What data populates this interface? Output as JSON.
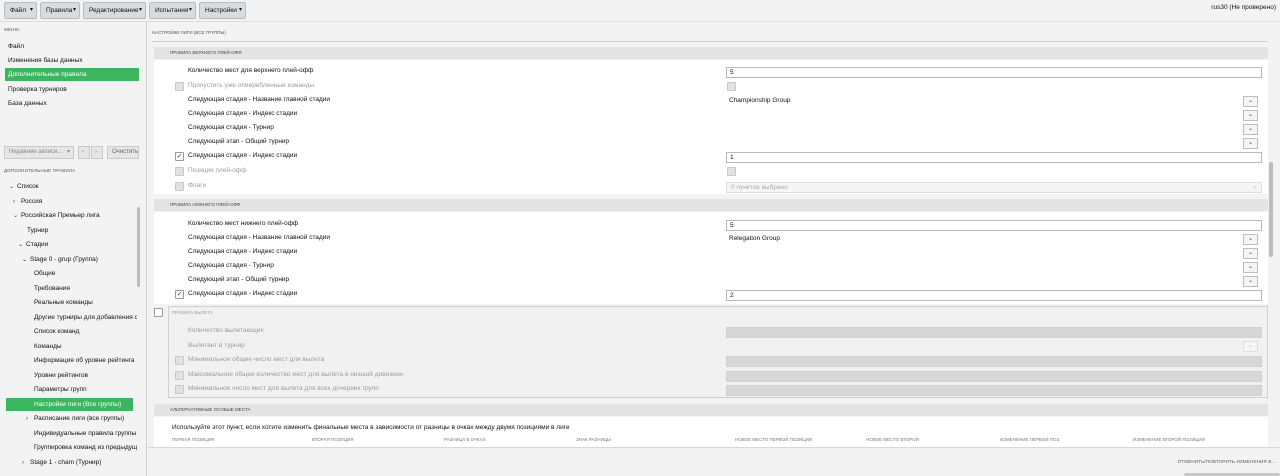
{
  "topbar": {
    "menus": [
      {
        "label": "Файл"
      },
      {
        "label": "Правила"
      },
      {
        "label": "Редактирование"
      },
      {
        "label": "Испытания"
      },
      {
        "label": "Настройки"
      }
    ],
    "user": "rus30 (Не проверено)"
  },
  "left": {
    "menu_title": "МЕНЮ",
    "nav": [
      "Файл",
      "Изменения базы данных",
      "Дополнительные правила",
      "Проверка турниров",
      "База данных"
    ],
    "history_placeholder": "Недавние записи...",
    "clear_label": "Очистить",
    "tree_title": "ДОПОЛНИТЕЛЬНЫЕ ПРАВИЛА",
    "tree": [
      {
        "label": "Список",
        "arrow": "down"
      },
      {
        "label": "Россия",
        "arrow": "right"
      },
      {
        "label": "Российская Премьер лига",
        "arrow": "down"
      },
      {
        "label": "Турнир",
        "arrow": ""
      },
      {
        "label": "Стадии",
        "arrow": "down"
      },
      {
        "label": "Stage 0 - grup (Группа)",
        "arrow": "down"
      },
      {
        "label": "Общие",
        "arrow": ""
      },
      {
        "label": "Требования",
        "arrow": ""
      },
      {
        "label": "Реальные команды",
        "arrow": ""
      },
      {
        "label": "Другие турниры для добавления ст",
        "arrow": ""
      },
      {
        "label": "Список команд",
        "arrow": ""
      },
      {
        "label": "Команды",
        "arrow": ""
      },
      {
        "label": "Информация об уровне рейтинга",
        "arrow": ""
      },
      {
        "label": "Уровни рейтингов",
        "arrow": ""
      },
      {
        "label": "Параметры групп",
        "arrow": ""
      },
      {
        "label": "Настройки лиги (Все группы)",
        "arrow": ""
      },
      {
        "label": "Расписание лиги (все группы)",
        "arrow": "right"
      },
      {
        "label": "Индивидуальные правила группы",
        "arrow": ""
      },
      {
        "label": "Группировка команд из предыдущ",
        "arrow": ""
      },
      {
        "label": "Stage 1 - cham (Турнир)",
        "arrow": "right"
      }
    ]
  },
  "main": {
    "breadcrumb": "НАСТРОЙКИ ЛИГИ (ВСЕ ГРУППЫ)",
    "upper": {
      "title": "ПРАВИЛА ВЕРХНЕГО ПЛЕЙ-ОФФ",
      "rows": [
        {
          "label": "Количество мест для верхнего плей-офф",
          "value": "5"
        },
        {
          "label": "Пропустить уже отмеребленные команды"
        },
        {
          "label": "Следующая стадия - Название главной стадии",
          "value": "Championship Group"
        },
        {
          "label": "Следующая стадия - Индекс стадии"
        },
        {
          "label": "Следующая стадия - Турнир"
        },
        {
          "label": "Следующий этап - Общий турнир"
        },
        {
          "label": "Следующая стадия - Индекс стадии",
          "value": "1"
        },
        {
          "label": "Позиция плей-офф"
        },
        {
          "label": "Флаги",
          "value": "0 пунктов выбрано"
        }
      ]
    },
    "lower": {
      "title": "ПРАВИЛА НИЖНЕГО ПЛЕЙ-ОФФ",
      "rows": [
        {
          "label": "Количество мест нижнего плей-офф",
          "value": "5"
        },
        {
          "label": "Следующая стадия - Название главной стадии",
          "value": "Relegation Group"
        },
        {
          "label": "Следующая стадия - Индекс стадии"
        },
        {
          "label": "Следующая стадия - Турнир"
        },
        {
          "label": "Следующий этап - Общий турнир"
        },
        {
          "label": "Следующая стадия - Индекс стадии",
          "value": "2"
        }
      ]
    },
    "relegation": {
      "title": "ПРАВИЛА ВЫЛЕТА",
      "rows": [
        {
          "label": "Количество вылетающих"
        },
        {
          "label": "Вылетает в турнир"
        },
        {
          "label": "Минимальное общее число мест для вылета"
        },
        {
          "label": "Максимальное общее количество мест для вылета в низший дивизион"
        },
        {
          "label": "Минимальное число мест для вылета для всех дочерних групп"
        }
      ]
    },
    "alt": {
      "title": "АЛЬТЕРНАТИВНЫЕ ОСОБЫЕ МЕСТА",
      "text": "Используйте этот пункт, если хотите изменить финальные места в зависимости от разницы в очках между двумя позициями в лиге",
      "columns": [
        "ПЕРВАЯ ПОЗИЦИЯ",
        "ВТОРАЯ ПОЗИЦИЯ",
        "РАЗНИЦА В ОЧКАХ",
        "ЗНАК РАЗНИЦЫ",
        "НОВОЕ МЕСТО ПЕРВОЙ ПОЗИЦИИ",
        "НОВОЕ МЕСТО ВТОРОЙ",
        "ИЗМЕНЕНИЕ ПЕРВОЙ ПОЗ.",
        "ИЗМЕНЕНИЕ ВТОРОЙ ПОЗИЦИИ"
      ]
    },
    "revert_label": "ОТМЕНИТЬ/ПОВТОРИТЬ ИЗМЕНЕНИЯ В..."
  }
}
